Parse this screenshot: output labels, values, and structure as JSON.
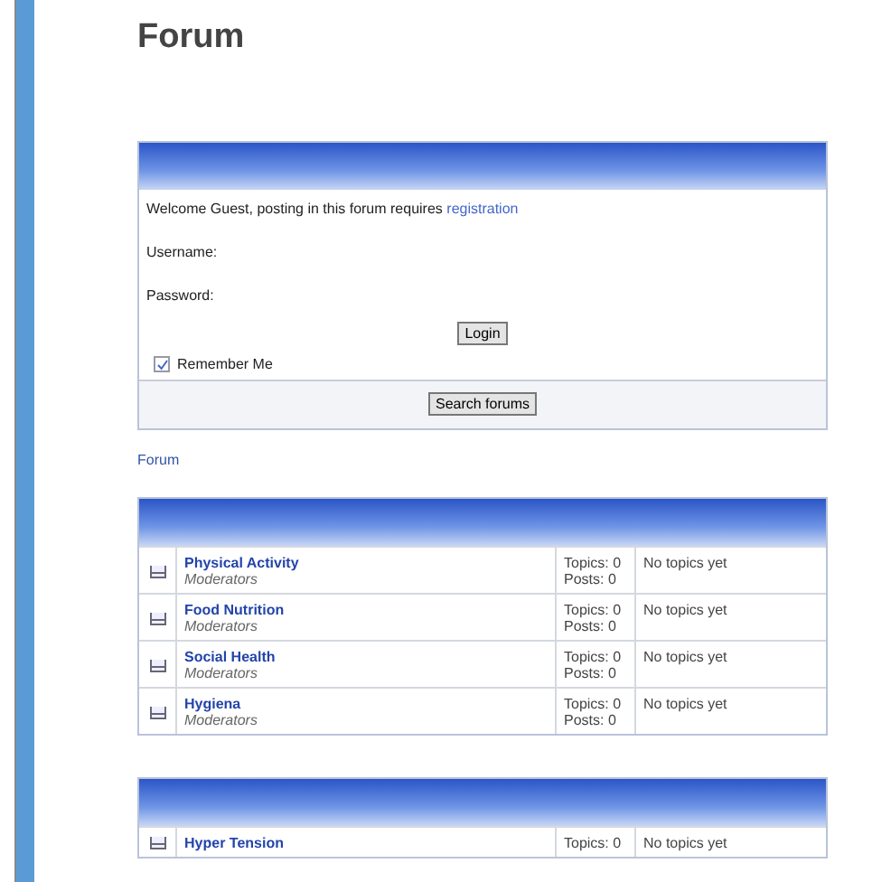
{
  "page": {
    "title": "Forum"
  },
  "login": {
    "welcome": "Welcome Guest, posting in this forum requires ",
    "register_link": "registration",
    "username_label": "Username:",
    "password_label": "Password:",
    "login_button": "Login",
    "remember": {
      "label": "Remember Me",
      "checked": true
    },
    "search_button": "Search forums"
  },
  "breadcrumb": "Forum",
  "categories": [
    {
      "forums": [
        {
          "name": "Physical Activity",
          "moderators": "Moderators",
          "topics": "Topics: 0",
          "posts": "Posts: 0",
          "last_post": "No topics yet"
        },
        {
          "name": "Food Nutrition",
          "moderators": "Moderators",
          "topics": "Topics: 0",
          "posts": "Posts: 0",
          "last_post": "No topics yet"
        },
        {
          "name": "Social Health",
          "moderators": "Moderators",
          "topics": "Topics: 0",
          "posts": "Posts: 0",
          "last_post": "No topics yet"
        },
        {
          "name": "Hygiena",
          "moderators": "Moderators",
          "topics": "Topics: 0",
          "posts": "Posts: 0",
          "last_post": "No topics yet"
        }
      ]
    },
    {
      "forums": [
        {
          "name": "Hyper Tension",
          "topics": "Topics: 0",
          "last_post": "No topics yet"
        }
      ]
    }
  ]
}
